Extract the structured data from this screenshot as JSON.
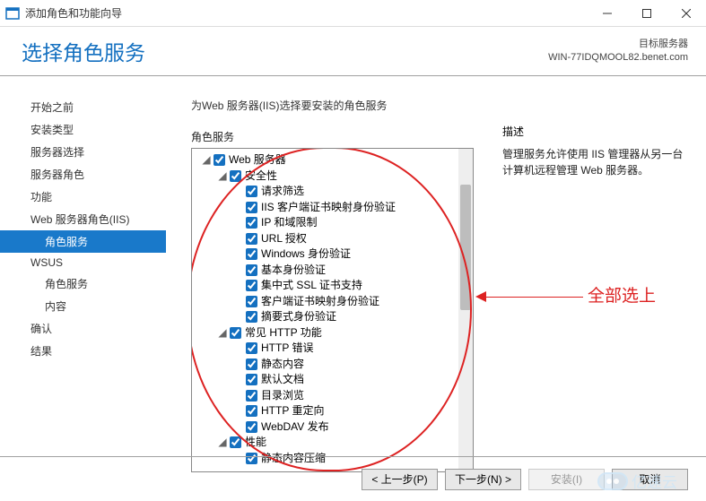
{
  "window": {
    "title": "添加角色和功能向导"
  },
  "page_title": "选择角色服务",
  "target_label": "目标服务器",
  "target_name": "WIN-77IDQMOOL82.benet.com",
  "sidebar": {
    "items": [
      {
        "label": "开始之前",
        "sub": false,
        "sel": false
      },
      {
        "label": "安装类型",
        "sub": false,
        "sel": false
      },
      {
        "label": "服务器选择",
        "sub": false,
        "sel": false
      },
      {
        "label": "服务器角色",
        "sub": false,
        "sel": false
      },
      {
        "label": "功能",
        "sub": false,
        "sel": false
      },
      {
        "label": "Web 服务器角色(IIS)",
        "sub": false,
        "sel": false
      },
      {
        "label": "角色服务",
        "sub": true,
        "sel": true
      },
      {
        "label": "WSUS",
        "sub": false,
        "sel": false
      },
      {
        "label": "角色服务",
        "sub": true,
        "sel": false
      },
      {
        "label": "内容",
        "sub": true,
        "sel": false
      },
      {
        "label": "确认",
        "sub": false,
        "sel": false
      },
      {
        "label": "结果",
        "sub": false,
        "sel": false
      }
    ]
  },
  "main_heading": "为Web 服务器(IIS)选择要安装的角色服务",
  "tree_section_label": "角色服务",
  "tree": [
    {
      "d": 0,
      "t": "open",
      "c": true,
      "label": "Web 服务器"
    },
    {
      "d": 1,
      "t": "open",
      "c": true,
      "label": "安全性"
    },
    {
      "d": 2,
      "t": "none",
      "c": true,
      "label": "请求筛选"
    },
    {
      "d": 2,
      "t": "none",
      "c": true,
      "label": "IIS 客户端证书映射身份验证"
    },
    {
      "d": 2,
      "t": "none",
      "c": true,
      "label": "IP 和域限制"
    },
    {
      "d": 2,
      "t": "none",
      "c": true,
      "label": "URL 授权"
    },
    {
      "d": 2,
      "t": "none",
      "c": true,
      "label": "Windows 身份验证"
    },
    {
      "d": 2,
      "t": "none",
      "c": true,
      "label": "基本身份验证"
    },
    {
      "d": 2,
      "t": "none",
      "c": true,
      "label": "集中式 SSL 证书支持"
    },
    {
      "d": 2,
      "t": "none",
      "c": true,
      "label": "客户端证书映射身份验证"
    },
    {
      "d": 2,
      "t": "none",
      "c": true,
      "label": "摘要式身份验证"
    },
    {
      "d": 1,
      "t": "open",
      "c": true,
      "label": "常见 HTTP 功能"
    },
    {
      "d": 2,
      "t": "none",
      "c": true,
      "label": "HTTP 错误"
    },
    {
      "d": 2,
      "t": "none",
      "c": true,
      "label": "静态内容"
    },
    {
      "d": 2,
      "t": "none",
      "c": true,
      "label": "默认文档"
    },
    {
      "d": 2,
      "t": "none",
      "c": true,
      "label": "目录浏览"
    },
    {
      "d": 2,
      "t": "none",
      "c": true,
      "label": "HTTP 重定向"
    },
    {
      "d": 2,
      "t": "none",
      "c": true,
      "label": "WebDAV 发布"
    },
    {
      "d": 1,
      "t": "open",
      "c": true,
      "label": "性能"
    },
    {
      "d": 2,
      "t": "none",
      "c": true,
      "label": "静态内容压缩"
    }
  ],
  "desc_label": "描述",
  "desc_text": "管理服务允许使用 IIS 管理器从另一台计算机远程管理 Web 服务器。",
  "annotation": "全部选上",
  "footer": {
    "prev": "< 上一步(P)",
    "next": "下一步(N) >",
    "install": "安装(I)",
    "cancel": "取消"
  },
  "watermark": "亿速云"
}
